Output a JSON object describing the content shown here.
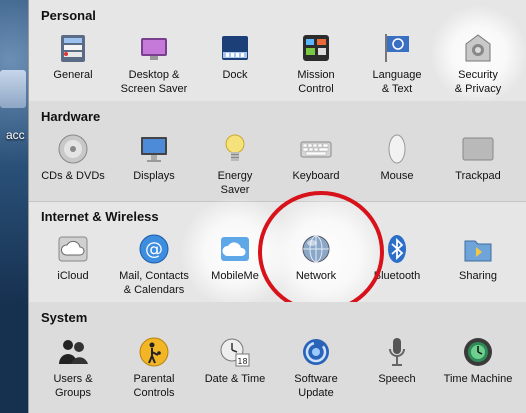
{
  "desktop": {
    "label": "acc"
  },
  "sections": [
    {
      "title": "Personal",
      "items": [
        {
          "label": "General",
          "icon": "general-icon"
        },
        {
          "label": "Desktop &\nScreen Saver",
          "icon": "desktop-screensaver-icon"
        },
        {
          "label": "Dock",
          "icon": "dock-icon"
        },
        {
          "label": "Mission\nControl",
          "icon": "mission-control-icon"
        },
        {
          "label": "Language\n& Text",
          "icon": "language-text-icon"
        },
        {
          "label": "Security\n& Privacy",
          "icon": "security-privacy-icon"
        }
      ]
    },
    {
      "title": "Hardware",
      "items": [
        {
          "label": "CDs & DVDs",
          "icon": "cd-dvd-icon"
        },
        {
          "label": "Displays",
          "icon": "displays-icon"
        },
        {
          "label": "Energy\nSaver",
          "icon": "energy-saver-icon"
        },
        {
          "label": "Keyboard",
          "icon": "keyboard-icon"
        },
        {
          "label": "Mouse",
          "icon": "mouse-icon"
        },
        {
          "label": "Trackpad",
          "icon": "trackpad-icon"
        }
      ]
    },
    {
      "title": "Internet & Wireless",
      "items": [
        {
          "label": "iCloud",
          "icon": "icloud-icon"
        },
        {
          "label": "Mail, Contacts\n& Calendars",
          "icon": "mail-contacts-icon"
        },
        {
          "label": "MobileMe",
          "icon": "mobileme-icon"
        },
        {
          "label": "Network",
          "icon": "network-icon"
        },
        {
          "label": "Bluetooth",
          "icon": "bluetooth-icon"
        },
        {
          "label": "Sharing",
          "icon": "sharing-icon"
        }
      ]
    },
    {
      "title": "System",
      "items": [
        {
          "label": "Users &\nGroups",
          "icon": "users-groups-icon"
        },
        {
          "label": "Parental\nControls",
          "icon": "parental-controls-icon"
        },
        {
          "label": "Date & Time",
          "icon": "date-time-icon"
        },
        {
          "label": "Software\nUpdate",
          "icon": "software-update-icon"
        },
        {
          "label": "Speech",
          "icon": "speech-icon"
        },
        {
          "label": "Time Machine",
          "icon": "time-machine-icon"
        }
      ]
    }
  ],
  "date_icon_day": "18",
  "colors": {
    "highlight_ring": "#d8121b",
    "pane_bg": "#e6e6e6"
  }
}
